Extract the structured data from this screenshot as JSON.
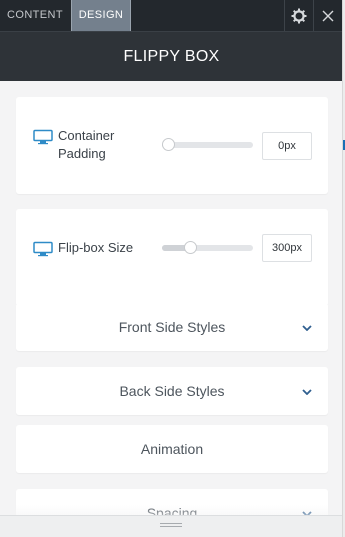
{
  "tabs": [
    {
      "label": "CONTENT",
      "active": false
    },
    {
      "label": "DESIGN",
      "active": true
    }
  ],
  "toolbar": {
    "settings_icon": "gear-icon",
    "close_icon": "close-icon"
  },
  "module": {
    "title": "FLIPPY BOX"
  },
  "settings": [
    {
      "label_line1": "Container",
      "label_line2": "Padding",
      "icon": "monitor-icon",
      "value": "0px",
      "slider_fraction": 0.0
    },
    {
      "label_line1": "Flip-box Size",
      "label_line2": "",
      "icon": "monitor-icon",
      "value": "300px",
      "slider_fraction": 0.28
    }
  ],
  "sections": [
    {
      "label": "Front Side Styles",
      "chevron": true
    },
    {
      "label": "Back Side Styles",
      "chevron": true
    },
    {
      "label": "Animation",
      "chevron": false
    },
    {
      "label": "Spacing",
      "chevron": true
    }
  ],
  "colors": {
    "tabbar_bg": "#23282d",
    "active_tab_bg": "#74808d",
    "title_bg": "#2e3338",
    "panel_bg": "#f4f4f5",
    "icon_accent": "#2e8bc7"
  }
}
